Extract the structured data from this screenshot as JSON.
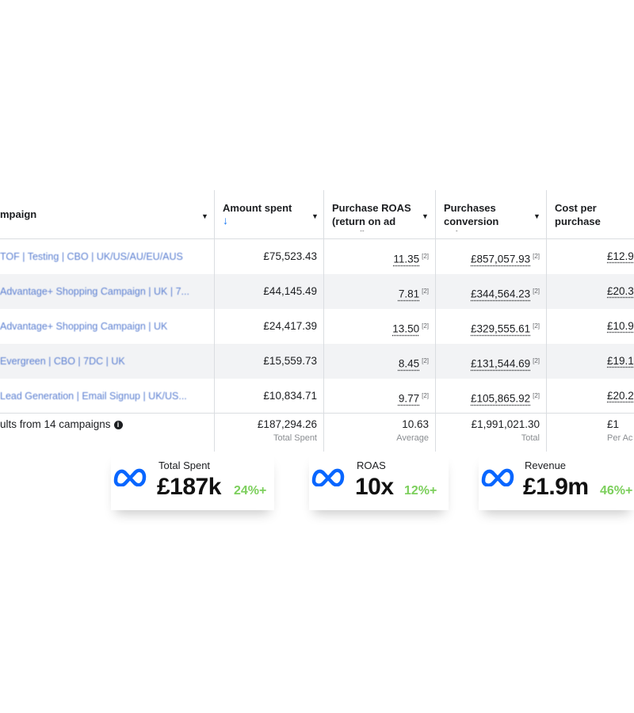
{
  "table": {
    "headers": {
      "campaign": "mpaign",
      "amount_spent": "Amount spent",
      "sort_arrow": "↓",
      "roas": "Purchase ROAS (return on ad spend)",
      "conversion_value": "Purchases conversion value",
      "cost_per_purchase": "Cost per purchase"
    },
    "rows": [
      {
        "campaign": "TOF | Testing | CBO | UK/US/AU/EU/AUS",
        "spent": "£75,523.43",
        "roas": "11.35",
        "value": "£857,057.93",
        "cpp": "£12.9"
      },
      {
        "campaign": "Advantage+ Shopping Campaign | UK | 7...",
        "spent": "£44,145.49",
        "roas": "7.81",
        "value": "£344,564.23",
        "cpp": "£20.3"
      },
      {
        "campaign": "Advantage+ Shopping Campaign | UK",
        "spent": "£24,417.39",
        "roas": "13.50",
        "value": "£329,555.61",
        "cpp": "£10.9"
      },
      {
        "campaign": "Evergreen | CBO | 7DC | UK",
        "spent": "£15,559.73",
        "roas": "8.45",
        "value": "£131,544.69",
        "cpp": "£19.1"
      },
      {
        "campaign": "Lead Generation | Email Signup | UK/US...",
        "spent": "£10,834.71",
        "roas": "9.77",
        "value": "£105,865.92",
        "cpp": "£20.2"
      }
    ],
    "footnote": "[2]",
    "totals": {
      "label": "ults from 14 campaigns",
      "info": "i",
      "spent": "£187,294.26",
      "spent_sub": "Total Spent",
      "roas": "10.63",
      "roas_sub": "Average",
      "value": "£1,991,021.30",
      "value_sub": "Total",
      "cpp": "£1",
      "cpp_sub": "Per Ac"
    }
  },
  "cards": [
    {
      "label": "Total Spent",
      "value": "£187k",
      "change": "24%+"
    },
    {
      "label": "ROAS",
      "value": "10x",
      "change": "12%+"
    },
    {
      "label": "Revenue",
      "value": "£1.9m",
      "change": "46%+"
    }
  ],
  "colors": {
    "meta_blue": "#0866ff",
    "positive_green": "#7ccf5c",
    "link_blue": "#5b7fd1"
  },
  "icons": {
    "brand": "meta-logo-icon",
    "sort": "arrow-down-icon",
    "dropdown": "caret-down-icon",
    "info": "info-icon"
  }
}
